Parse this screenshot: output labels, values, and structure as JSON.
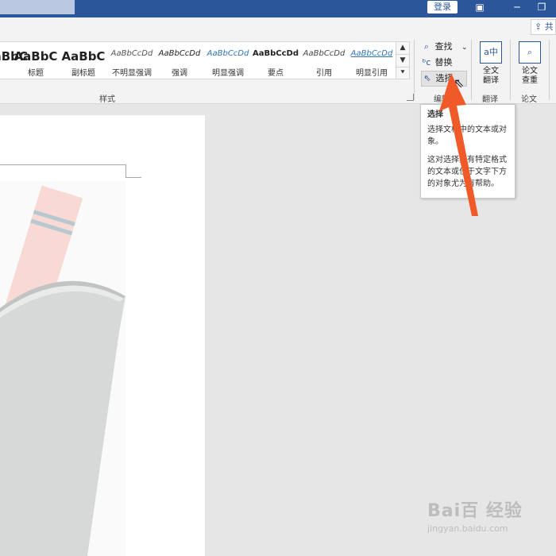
{
  "titlebar": {
    "login_label": "登录",
    "restore_icon": "restore-icon",
    "minimize_icon": "minimize-icon",
    "maximize_icon": "maximize-icon",
    "accent_color": "#2b579a"
  },
  "share": {
    "label": "共"
  },
  "styles_group": {
    "label": "样式",
    "items": [
      {
        "sample": "AaBbC",
        "name": ""
      },
      {
        "sample": "AaBbC",
        "name": "标题"
      },
      {
        "sample": "AaBbC",
        "name": "副标题"
      },
      {
        "sample": "AaBbCcDd",
        "name": "不明显强调"
      },
      {
        "sample": "AaBbCcDd",
        "name": "强调"
      },
      {
        "sample": "AaBbCcDd",
        "name": "明显强调"
      },
      {
        "sample": "AaBbCcDd",
        "name": "要点"
      },
      {
        "sample": "AaBbCcDd",
        "name": "引用"
      },
      {
        "sample": "AaBbCcDd",
        "name": "明显引用"
      }
    ]
  },
  "editing_group": {
    "label": "编辑",
    "find_label": "查找",
    "replace_label": "替换",
    "select_label": "选择"
  },
  "translate_group": {
    "button_label_line1": "全文",
    "button_label_line2": "翻译",
    "label": "翻译"
  },
  "paper_group": {
    "button_label_line1": "论文",
    "button_label_line2": "查重",
    "label": "论文"
  },
  "tooltip": {
    "title": "选择",
    "line1": "选择文档中的文本或对象。",
    "line2": "这对选择具有特定格式的文本或位于文字下方的对象尤为有帮助。"
  },
  "watermark": {
    "main": "Bai百 经验",
    "sub": "jingyan.baidu.com"
  },
  "annotation": {
    "arrow_color": "#f05a28"
  }
}
